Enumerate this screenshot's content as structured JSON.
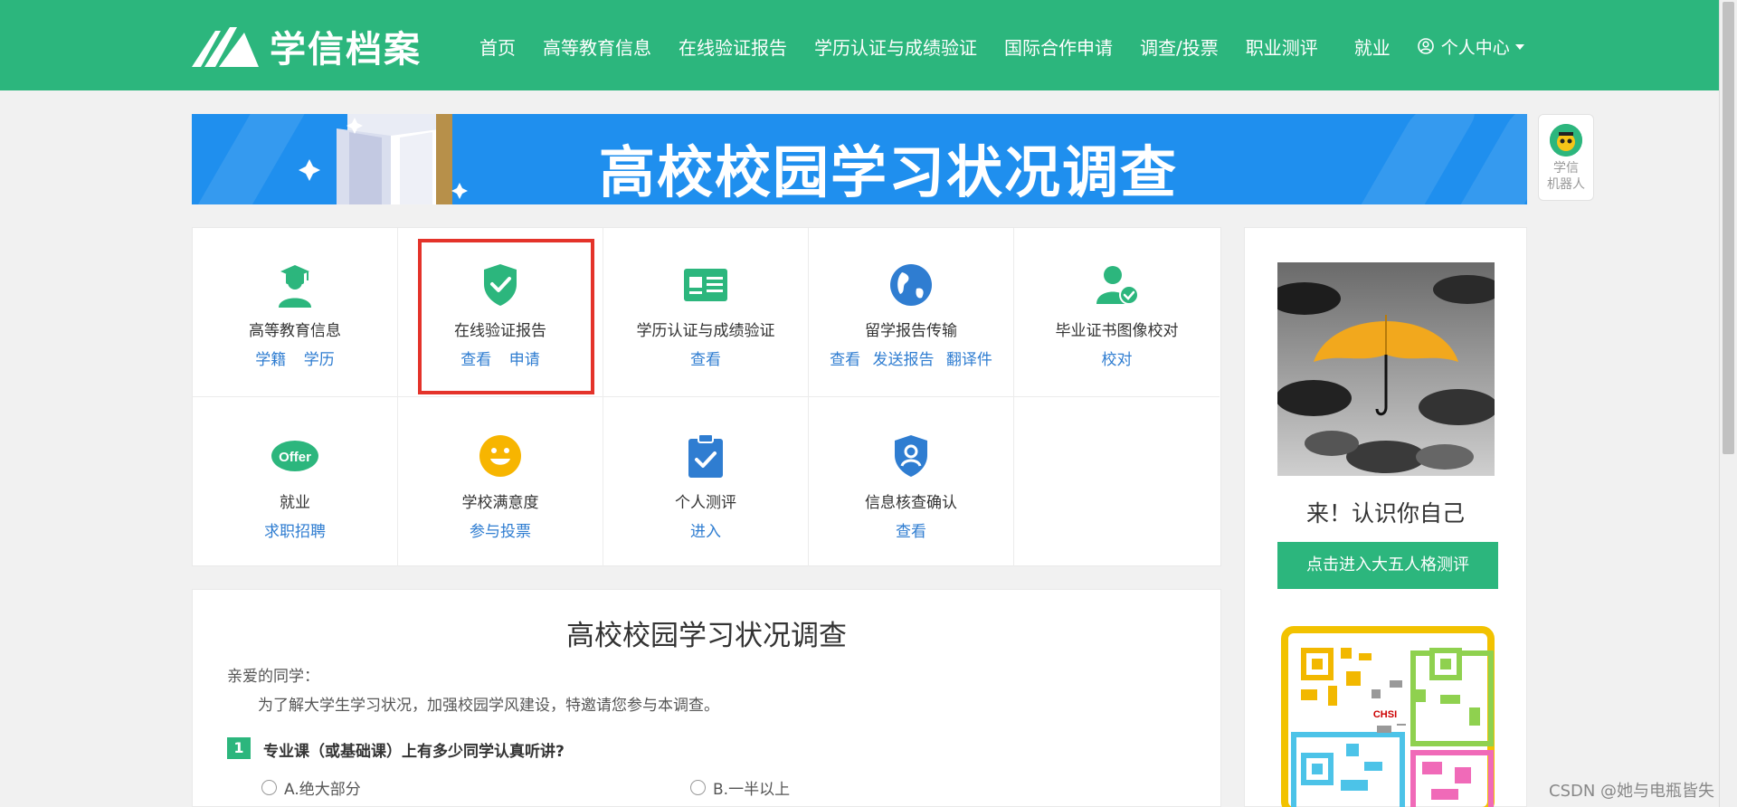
{
  "header": {
    "logo_text": "学信档案",
    "nav": [
      "首页",
      "高等教育信息",
      "在线验证报告",
      "学历认证与成绩验证",
      "国际合作申请",
      "调查/投票",
      "职业测评",
      "就业"
    ],
    "user_menu": "个人中心"
  },
  "banner": {
    "title": "高校校园学习状况调查"
  },
  "robot": {
    "line1": "学信",
    "line2": "机器人"
  },
  "services": [
    {
      "title": "高等教育信息",
      "links": [
        "学籍",
        "学历"
      ],
      "icon": "graduate-icon"
    },
    {
      "title": "在线验证报告",
      "links": [
        "查看",
        "申请"
      ],
      "icon": "shield-check-icon"
    },
    {
      "title": "学历认证与成绩验证",
      "links": [
        "查看"
      ],
      "icon": "id-card-icon"
    },
    {
      "title": "留学报告传输",
      "links": [
        "查看",
        "发送报告",
        "翻译件"
      ],
      "icon": "globe-icon"
    },
    {
      "title": "毕业证书图像校对",
      "links": [
        "校对"
      ],
      "icon": "user-check-icon"
    },
    {
      "title": "就业",
      "links": [
        "求职招聘"
      ],
      "icon": "offer-icon"
    },
    {
      "title": "学校满意度",
      "links": [
        "参与投票"
      ],
      "icon": "smile-icon"
    },
    {
      "title": "个人测评",
      "links": [
        "进入"
      ],
      "icon": "clipboard-check-icon"
    },
    {
      "title": "信息核查确认",
      "links": [
        "查看"
      ],
      "icon": "shield-user-icon"
    }
  ],
  "side": {
    "caption": "来！认识你自己",
    "button": "点击进入大五人格测评",
    "qr_logo": "CHSI"
  },
  "survey": {
    "title": "高校校园学习状况调查",
    "greeting": "亲爱的同学：",
    "intro": "为了解大学生学习状况，加强校园学风建设，特邀请您参与本调查。",
    "q_num": "1",
    "question": "专业课（或基础课）上有多少同学认真听讲?",
    "options": [
      "A.绝大部分",
      "B.一半以上"
    ]
  },
  "watermark": "CSDN @她与电瓶皆失",
  "colors": {
    "brand": "#2cb67d",
    "link": "#2f7dd1",
    "banner": "#1f8fee",
    "highlight": "#e4332a"
  }
}
